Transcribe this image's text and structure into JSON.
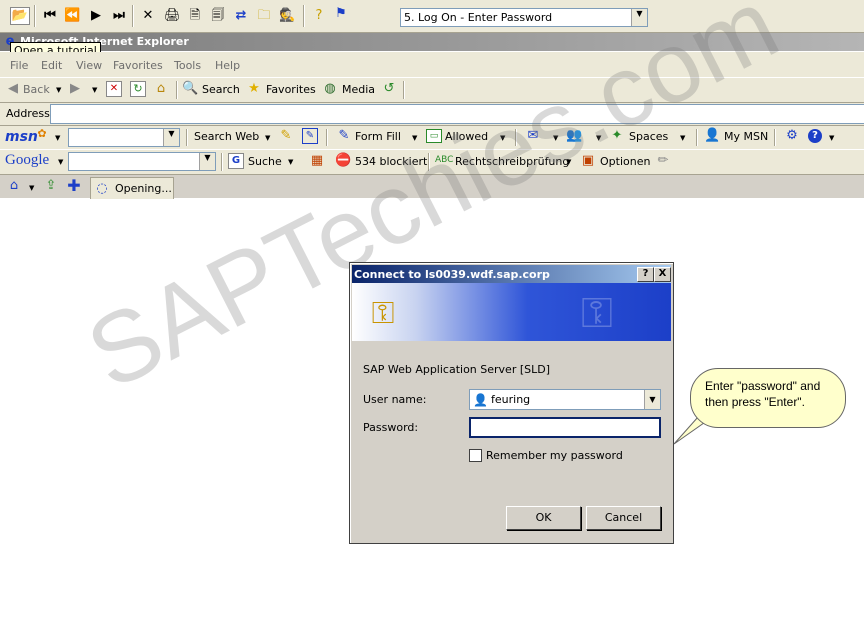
{
  "recorder": {
    "step_select": "5. Log On - Enter Password",
    "tooltip": "Open a tutorial"
  },
  "browser": {
    "title": "Microsoft Internet Explorer",
    "menu": [
      "File",
      "Edit",
      "View",
      "Favorites",
      "Tools",
      "Help"
    ],
    "back_label": "Back",
    "search_label": "Search",
    "favorites_label": "Favorites",
    "media_label": "Media",
    "address_label": "Address",
    "tab_label": "Opening..."
  },
  "msn_toolbar": {
    "logo": "msn",
    "search_web": "Search Web",
    "form_fill": "Form Fill",
    "allowed": "Allowed",
    "spaces": "Spaces",
    "my_msn": "My MSN"
  },
  "google_toolbar": {
    "logo": "Google",
    "suche": "Suche",
    "blocked": "534 blockiert",
    "spellcheck": "Rechtschreibprüfung",
    "options": "Optionen"
  },
  "dialog": {
    "title": "Connect to ls0039.wdf.sap.corp",
    "help_btn": "?",
    "close_btn": "X",
    "server": "SAP Web Application Server [SLD]",
    "username_label": "User name:",
    "username_value": "feuring",
    "password_label": "Password:",
    "password_value": "",
    "remember_label": "Remember my password",
    "ok_label": "OK",
    "cancel_label": "Cancel"
  },
  "callout": {
    "line1": "Enter \"password\" and",
    "line2": "then press \"Enter\"."
  },
  "watermark": "SAPTechies.com"
}
